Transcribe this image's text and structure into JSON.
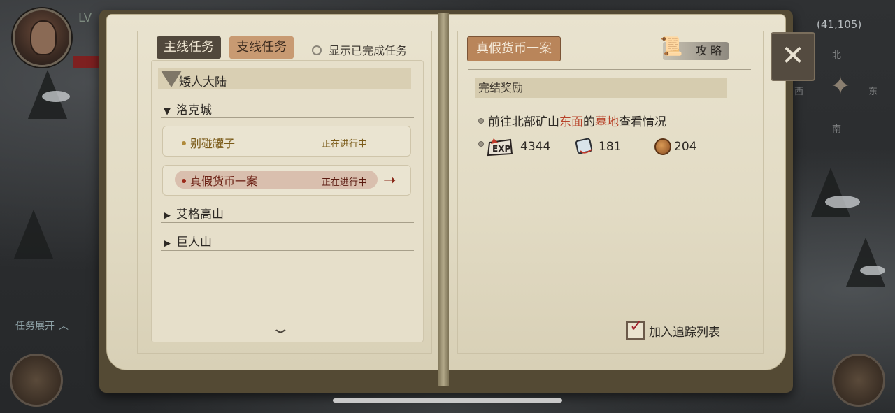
{
  "hud": {
    "level_label": "LV",
    "task_expand": "任务展开",
    "coordinates": "(41,105)",
    "compass": {
      "north": "北",
      "west": "西",
      "east": "东",
      "south": "南"
    }
  },
  "left_page": {
    "tabs": {
      "main": "主线任务",
      "side": "支线任务"
    },
    "show_completed": "显示已完成任务",
    "region": "矮人大陆",
    "city": "洛克城",
    "quests": [
      {
        "name": "别碰罐子",
        "status": "正在进行中",
        "selected": false
      },
      {
        "name": "真假货币一案",
        "status": "正在进行中",
        "selected": true
      }
    ],
    "groups": [
      "艾格高山",
      "巨人山"
    ]
  },
  "right_page": {
    "quest_title": "真假货币一案",
    "guide_button": "攻 略",
    "reward_header": "完结奖励",
    "objective": {
      "part1": "前往北部矿山",
      "highlight1": "东面",
      "part2": "的",
      "highlight2": "墓地",
      "part3": "查看情况"
    },
    "rewards": {
      "exp": "4344",
      "cards": "181",
      "coins": "204"
    },
    "track_label": "加入追踪列表",
    "track_checked": true
  },
  "icons": {
    "close": "close-icon",
    "exp": "exp-icon",
    "card": "card-icon",
    "coin": "coin-icon",
    "guide": "scroll-icon"
  },
  "colors": {
    "highlight": "#b8432a",
    "selected_quest": "#6a1e12",
    "tab_main_bg": "#51483c",
    "tab_side_bg": "#c89a72",
    "title_bg": "#b9855a"
  }
}
